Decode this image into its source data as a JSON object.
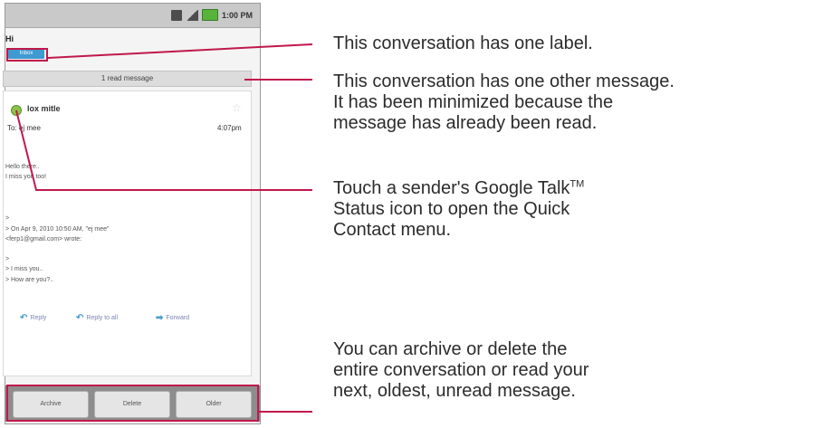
{
  "status_bar": {
    "time": "1:00 PM"
  },
  "conversation": {
    "subject": "Hi",
    "label": "Inbox",
    "read_bar": "1 read message"
  },
  "message": {
    "sender": "lox mitle",
    "recipient": "To: ej mee",
    "time": "4:07pm",
    "body": [
      "Hello there..",
      "I miss you too!",
      ">",
      "> On Apr 9, 2010 10:50 AM, \"ej mee\"",
      "<ferp1@gmail.com> wrote:",
      ">",
      "> I miss you..",
      "> How are you?.."
    ],
    "actions": [
      "Reply",
      "Reply to all",
      "Forward"
    ]
  },
  "bottom_buttons": [
    "Archive",
    "Delete",
    "Older"
  ],
  "callouts": {
    "label": [
      "This conversation has one label."
    ],
    "read_message": [
      "This conversation has one other message.",
      "It has been minimized because the",
      "message has already been read."
    ],
    "status_icon": [
      "Touch a sender's Google Talk",
      "Status icon to open the Quick",
      "Contact menu."
    ],
    "status_icon_tm": "TM",
    "buttons": [
      "You can archive or delete the",
      "entire conversation or read your",
      "next, oldest, unread message."
    ]
  },
  "colors": {
    "highlight": "#c0184c",
    "label_chip": "#3e9ad1",
    "presence": "#8bc34a"
  }
}
